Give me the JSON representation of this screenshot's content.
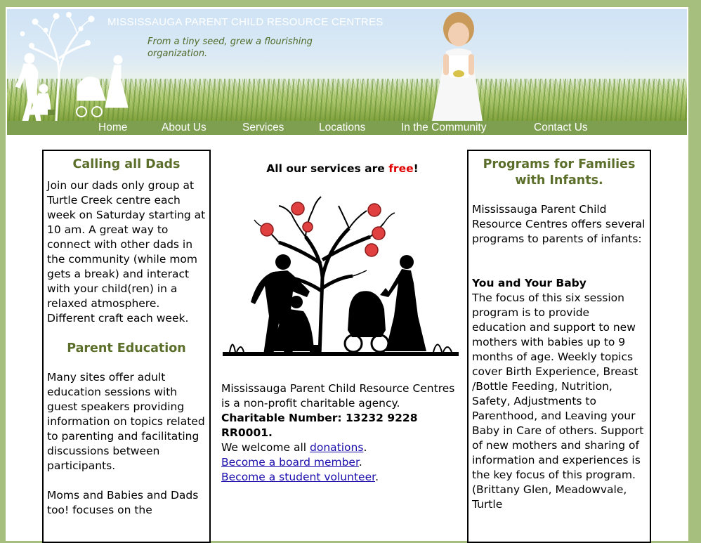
{
  "header": {
    "site_title": "MISSISSAUGA PARENT CHILD RESOURCE CENTRES",
    "tagline": "From a tiny seed, grew a flourishing organization."
  },
  "nav": {
    "items": [
      {
        "label": "Home"
      },
      {
        "label": "About Us"
      },
      {
        "label": "Services"
      },
      {
        "label": "Locations"
      },
      {
        "label": "In the Community"
      },
      {
        "label": "Contact Us"
      }
    ]
  },
  "left_column": {
    "heading1": "Calling all Dads",
    "para1": "Join our dads only group at Turtle Creek centre each week on Saturday starting at 10 am. A great way to connect with other dads in the community (while mom gets a break) and interact with your child(ren) in a relaxed atmosphere. Different craft each week.",
    "heading2": "Parent Education",
    "para2": "Many sites offer adult education sessions with guest speakers providing information on topics related to parenting and facilitating discussions between participants.",
    "para3": "Moms and Babies and Dads too! focuses on the"
  },
  "center_column": {
    "free_prefix": "All our services are ",
    "free_word": "free",
    "free_suffix": "!",
    "charity_text": "Mississauga Parent Child Resource Centres is a non-profit charitable agency.",
    "charity_number": "Charitable Number: 13232 9228 RR0001.",
    "welcome_prefix": "We welcome all ",
    "donations_link": "donations",
    "period": ".",
    "board_link": "Become a board member",
    "volunteer_link": "Become a student volunteer"
  },
  "right_column": {
    "heading": "Programs for Families with Infants.",
    "intro": "Mississauga Parent Child Resource Centres offers several programs to parents of infants:",
    "program_title": "You and Your Baby",
    "program_text": "The focus of this six session program is to provide education and support to new mothers with babies up to 9 months of age. Weekly topics cover Birth Experience, Breast /Bottle Feeding, Nutrition, Safety, Adjustments to Parenthood, and Leaving your Baby in Care of others. Support of new mothers and sharing of information and experiences is the key focus of this program. (Brittany Glen, Meadowvale, Turtle"
  },
  "colors": {
    "background": "#a6bf7e",
    "nav": "#7e9e50",
    "heading": "#5b6e2a",
    "free": "#e00000",
    "link": "#1a0dab"
  }
}
